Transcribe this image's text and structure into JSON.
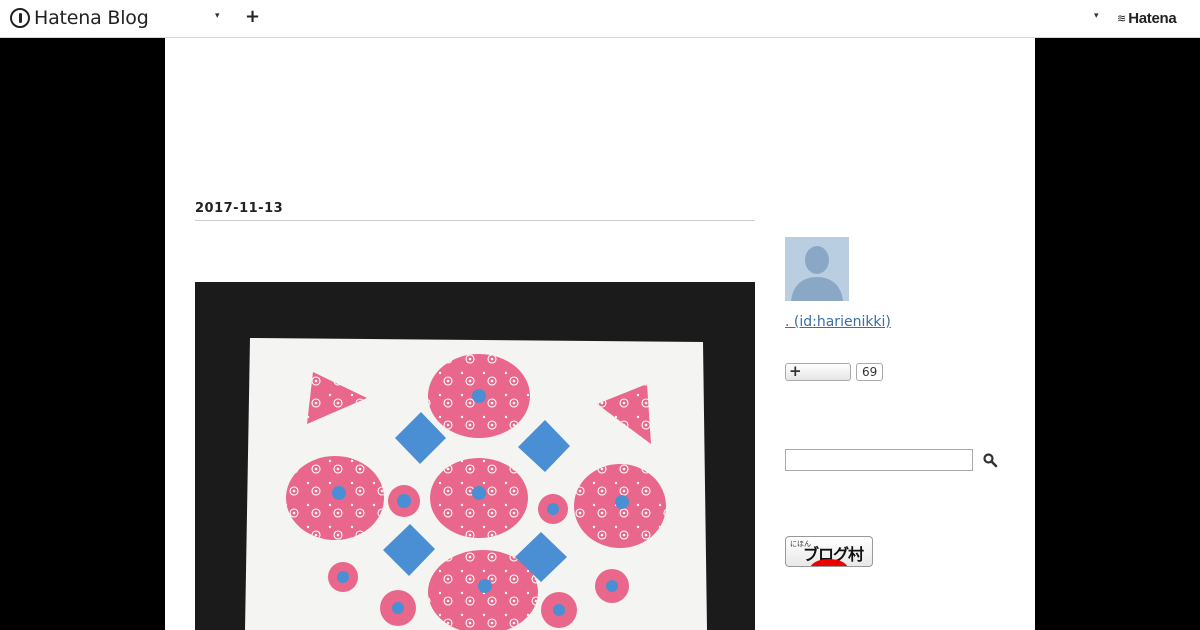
{
  "header": {
    "brand": "Hatena Blog",
    "hatena_logo": "Hatena",
    "caret": "▾",
    "plus": "+"
  },
  "entry": {
    "date": "2017-11-13"
  },
  "sidebar": {
    "profile_id": ". (id:harienikki)",
    "bookmark_plus": "+",
    "bookmark_count": "69",
    "search_placeholder": "",
    "blogmura_small": "にほん",
    "blogmura_big": "ブログ村"
  },
  "colors": {
    "accent_link": "#3b6da6",
    "page_bg": "#000000",
    "pink": "#e8678a",
    "blue": "#4a8fd3"
  }
}
